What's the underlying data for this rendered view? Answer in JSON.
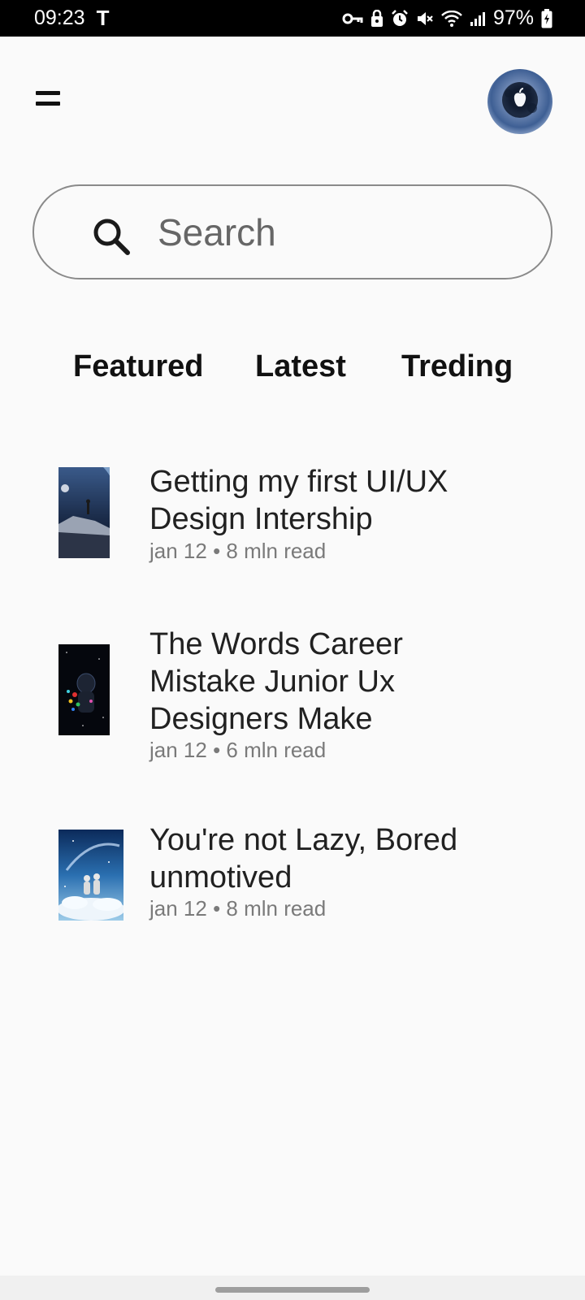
{
  "status_bar": {
    "time": "09:23",
    "carrier_icon": "T",
    "battery_percent": "97%",
    "icons": [
      "vpn-key-icon",
      "lock-icon",
      "alarm-icon",
      "mute-icon",
      "wifi-icon",
      "signal-icon",
      "battery-charging-icon"
    ]
  },
  "header": {
    "menu_icon": "hamburger-menu-icon",
    "avatar_icon": "profile-avatar"
  },
  "search": {
    "placeholder": "Search"
  },
  "tabs": [
    {
      "label": "Featured"
    },
    {
      "label": "Latest"
    },
    {
      "label": "Treding"
    }
  ],
  "articles": [
    {
      "title_line1": "Getting my first UI/UX",
      "title_line2": "Design Intership",
      "title_line3": "",
      "meta": "jan 12 • 8 mln read"
    },
    {
      "title_line1": "The Words Career",
      "title_line2": "Mistake Junior Ux",
      "title_line3": "Designers Make",
      "meta": "jan 12 • 6 mln read"
    },
    {
      "title_line1": "You're not Lazy, Bored",
      "title_line2": "unmotived",
      "title_line3": "",
      "meta": "jan 12 • 8 mln read"
    }
  ],
  "colors": {
    "background": "#fafafa",
    "text_primary": "#212121",
    "text_meta": "#7a7a7a",
    "search_border": "#8a8a8a"
  }
}
